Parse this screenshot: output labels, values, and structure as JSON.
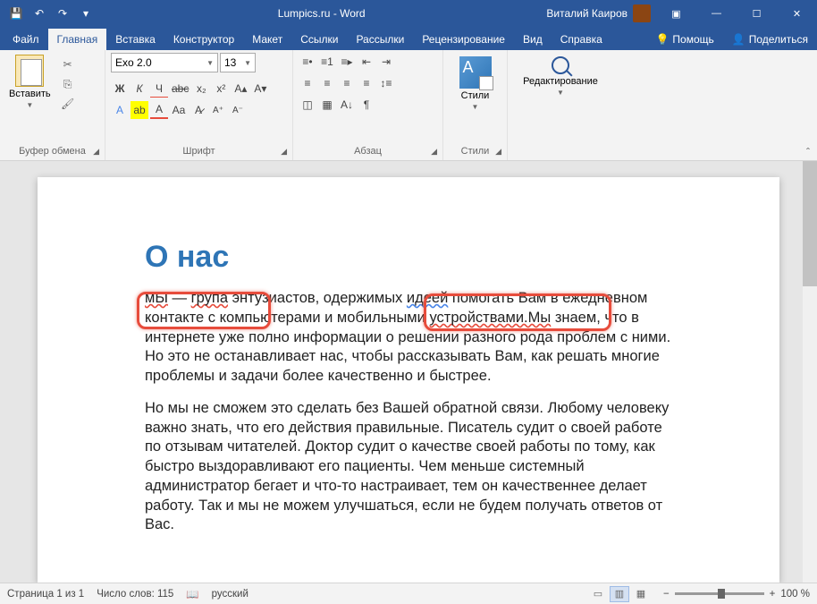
{
  "titlebar": {
    "title": "Lumpics.ru - Word",
    "user": "Виталий Каиров"
  },
  "tabs": {
    "file": "Файл",
    "home": "Главная",
    "insert": "Вставка",
    "design": "Конструктор",
    "layout": "Макет",
    "references": "Ссылки",
    "mailings": "Рассылки",
    "review": "Рецензирование",
    "view": "Вид",
    "help": "Справка",
    "tell_me": "Помощь",
    "share": "Поделиться"
  },
  "ribbon": {
    "clipboard": {
      "label": "Буфер обмена",
      "paste": "Вставить"
    },
    "font": {
      "label": "Шрифт",
      "name": "Exo 2.0",
      "size": "13"
    },
    "paragraph": {
      "label": "Абзац"
    },
    "styles": {
      "label": "Стили",
      "button": "Стили"
    },
    "editing": {
      "label": "Редактирование"
    }
  },
  "document": {
    "heading": "О нас",
    "p1_error_a": "мЫ",
    "p1_part1": " — ",
    "p1_error_b": "група",
    "p1_part2": " энтузиастов, одержимых ",
    "p1_error_c": "идеей",
    "p1_part2b": " помогать Вам в ежедневном контакте с компьютерами и мобильными ",
    "p1_error_d": "устройствами.Мы",
    "p1_part3": " знаем, что в интернете уже полно информации о решении разного рода проблем с ними. Но это не останавливает нас, чтобы рассказывать Вам, как решать многие проблемы и задачи более качественно и быстрее.",
    "p2": "Но мы не сможем это сделать без Вашей обратной связи. Любому человеку важно знать, что его действия правильные. Писатель судит о своей работе по отзывам читателей. Доктор судит о качестве своей работы по тому, как быстро выздоравливают его пациенты. Чем меньше системный администратор бегает и что-то настраивает, тем он качественнее делает работу. Так и мы не можем улучшаться, если не будем получать ответов от Вас."
  },
  "statusbar": {
    "page": "Страница 1 из 1",
    "words": "Число слов: 115",
    "language": "русский",
    "zoom": "100 %"
  }
}
